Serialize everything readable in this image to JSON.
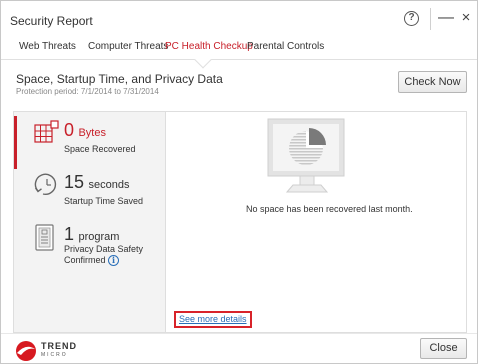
{
  "window": {
    "title": "Security Report",
    "help_icon": "help-circle-icon",
    "minimize_icon": "minimize-icon",
    "close_icon": "close-icon",
    "help_glyph": "?",
    "minimize_glyph": "—",
    "close_glyph": "×"
  },
  "tabs": [
    {
      "label": "Web Threats",
      "active": false
    },
    {
      "label": "Computer Threats",
      "active": false
    },
    {
      "label": "PC Health Checkup",
      "active": true
    },
    {
      "label": "Parental Controls",
      "active": false
    }
  ],
  "header": {
    "title": "Space, Startup Time, and Privacy Data",
    "protection_period": "Protection period: 7/1/2014 to 7/31/2014",
    "check_now_label": "Check Now"
  },
  "metrics": [
    {
      "icon": "disk-space-icon",
      "value": "0",
      "unit": "Bytes",
      "label": "Space Recovered"
    },
    {
      "icon": "clock-icon",
      "value": "15",
      "unit": "seconds",
      "label": "Startup Time Saved"
    },
    {
      "icon": "document-icon",
      "value": "1",
      "unit": "program",
      "label_line1": "Privacy Data Safety",
      "label_line2": "Confirmed",
      "info_icon": "info-icon",
      "info_glyph": "i"
    }
  ],
  "main": {
    "illustration_icon": "monitor-pie-chart-icon",
    "message": "No space has been recovered last month.",
    "see_more_label": "See more details"
  },
  "footer": {
    "brand": "TREND",
    "brand_sub": "MICRO",
    "close_label": "Close"
  },
  "colors": {
    "accent": "#c8202a",
    "link": "#2a6fb8",
    "highlight_box": "#d8232a"
  }
}
